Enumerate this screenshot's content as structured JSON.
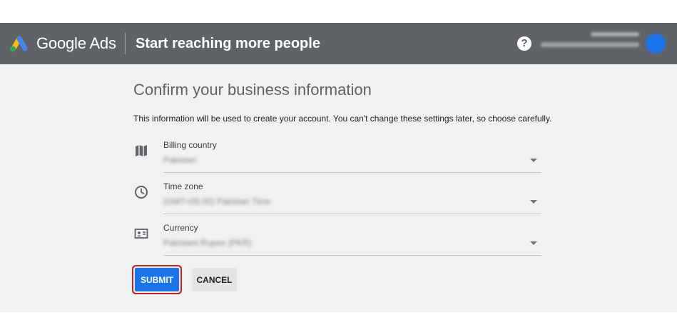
{
  "header": {
    "brand": "Google Ads",
    "heading": "Start reaching more people",
    "help_icon": "help-circle-icon",
    "help_glyph": "?",
    "account_name": "",
    "account_email": ""
  },
  "form": {
    "title": "Confirm your business information",
    "intro": "This information will be used to create your account. You can't change these settings later, so choose carefully.",
    "fields": [
      {
        "label": "Billing country",
        "value": "Pakistan",
        "icon": "map-icon"
      },
      {
        "label": "Time zone",
        "value": "(GMT+05:00) Pakistan Time",
        "icon": "clock-icon"
      },
      {
        "label": "Currency",
        "value": "Pakistani Rupee (PKR)",
        "icon": "id-card-icon"
      }
    ],
    "submit_label": "SUBMIT",
    "cancel_label": "CANCEL"
  },
  "colors": {
    "header_bg": "#5f6368",
    "content_bg": "#f1f1f1",
    "primary": "#1a73e8",
    "focus_outline": "#c5221f"
  }
}
